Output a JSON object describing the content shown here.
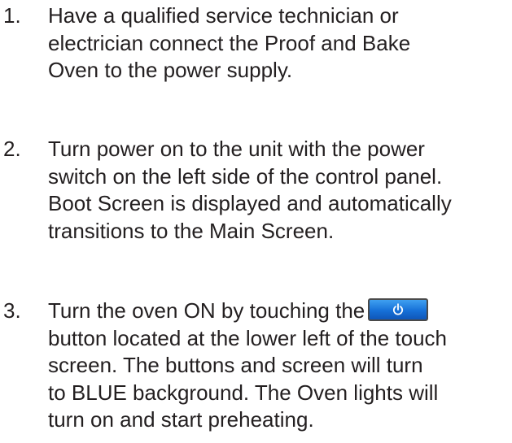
{
  "steps": [
    {
      "number": "1.",
      "lines": [
        "Have a qualified service technician or",
        "electrician connect the Proof and Bake",
        "Oven to the power supply."
      ]
    },
    {
      "number": "2.",
      "lines": [
        "Turn power on to the unit with the power",
        "switch on the left side of the control panel.",
        "Boot Screen is displayed and automatically",
        "transitions to the Main Screen."
      ]
    },
    {
      "number": "3.",
      "line1_before_button": "Turn the oven ON by touching the",
      "button_icon": "power-icon",
      "button_color": "#1670d8",
      "lines": [
        "button located at the lower left of the touch",
        "screen. The buttons and screen will turn",
        "to BLUE background. The Oven lights will",
        "turn on and start preheating."
      ]
    }
  ]
}
